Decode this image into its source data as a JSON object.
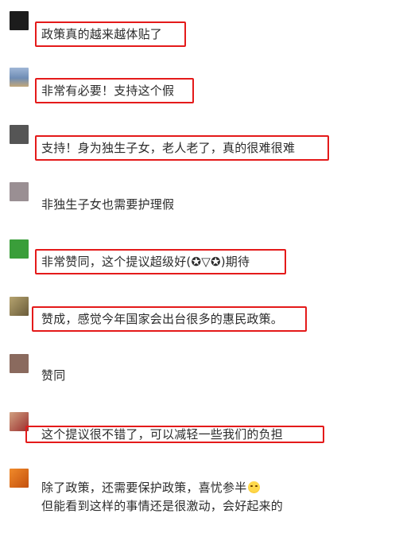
{
  "comments": [
    {
      "text": "政策真的越来越体贴了",
      "highlighted": true,
      "avatar_color": "#1c1c1c"
    },
    {
      "text": "非常有必要！支持这个假",
      "highlighted": true,
      "avatar_color": "#6f8db5"
    },
    {
      "text": "支持！身为独生子女，老人老了，真的很难很难",
      "highlighted": true,
      "avatar_color": "#555555"
    },
    {
      "text": "非独生子女也需要护理假",
      "highlighted": false,
      "avatar_color": "#9a8f93"
    },
    {
      "text": "非常赞同，这个提议超级好(✪▽✪)期待",
      "highlighted": true,
      "avatar_color": "#3a9e3a"
    },
    {
      "text": "赞成，感觉今年国家会出台很多的惠民政策。",
      "highlighted": true,
      "avatar_color": "#8a7a52"
    },
    {
      "text": "赞同",
      "highlighted": false,
      "avatar_color": "#8a6a5e"
    },
    {
      "text": "这个提议很不错了，可以减轻一些我们的负担",
      "highlighted": true,
      "avatar_color": "#b0593b"
    },
    {
      "text": "除了政策，还需要保护政策，喜忧参半",
      "text_line2": "但能看到这样的事情还是很激动，会好起来的",
      "highlighted": false,
      "avatar_color": "#d9681e",
      "emoji": "crying-laughing-emoji"
    }
  ],
  "colors": {
    "highlight_border": "#e41a1a",
    "text": "#2b2b2b",
    "background": "#ffffff"
  }
}
